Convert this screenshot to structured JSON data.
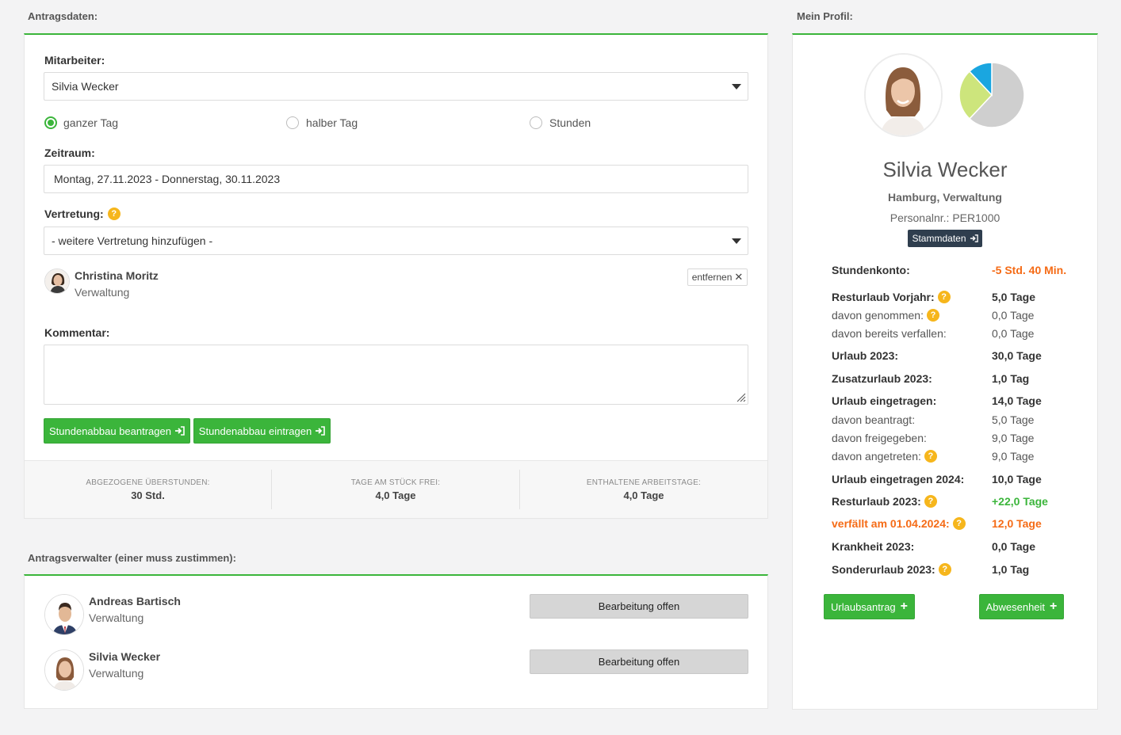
{
  "application": {
    "title": "Antragsdaten:",
    "employee": {
      "label": "Mitarbeiter:",
      "value": "Silvia Wecker"
    },
    "day_type": {
      "options": [
        {
          "label": "ganzer Tag",
          "selected": true
        },
        {
          "label": "halber Tag",
          "selected": false
        },
        {
          "label": "Stunden",
          "selected": false
        }
      ]
    },
    "period": {
      "label": "Zeitraum:",
      "value": "Montag, 27.11.2023 - Donnerstag, 30.11.2023"
    },
    "substitute": {
      "label": "Vertretung:",
      "select_value": "- weitere Vertretung hinzufügen -",
      "person": {
        "name": "Christina Moritz",
        "department": "Verwaltung"
      },
      "remove_label": "entfernen"
    },
    "comment": {
      "label": "Kommentar:",
      "value": ""
    },
    "buttons": {
      "request": "Stundenabbau beantragen",
      "enter": "Stundenabbau eintragen"
    },
    "stats": [
      {
        "label": "ABGEZOGENE ÜBERSTUNDEN:",
        "value": "30 Std."
      },
      {
        "label": "TAGE AM STÜCK FREI:",
        "value": "4,0 Tage"
      },
      {
        "label": "ENTHALTENE ARBEITSTAGE:",
        "value": "4,0 Tage"
      }
    ]
  },
  "approvers": {
    "title": "Antragsverwalter (einer muss zustimmen):",
    "items": [
      {
        "name": "Andreas Bartisch",
        "department": "Verwaltung",
        "status": "Bearbeitung offen"
      },
      {
        "name": "Silvia Wecker",
        "department": "Verwaltung",
        "status": "Bearbeitung offen"
      }
    ]
  },
  "profile": {
    "title": "Mein Profil:",
    "name": "Silvia Wecker",
    "location": "Hamburg, Verwaltung",
    "personnel_no": "Personalnr.: PER1000",
    "master_data_button": "Stammdaten",
    "pie": {
      "slices": [
        {
          "name": "gray",
          "value": 62,
          "color": "#cfcfcf"
        },
        {
          "name": "lime",
          "value": 26,
          "color": "#cde57c"
        },
        {
          "name": "blue",
          "value": 12,
          "color": "#1aa6e0"
        }
      ]
    },
    "rows": [
      {
        "key": "Stundenkonto:",
        "value": "-5 Std. 40 Min.",
        "kstyle": "b",
        "vstyle": "orange",
        "help": false
      },
      {
        "key": "Resturlaub Vorjahr:",
        "value": "5,0 Tage",
        "kstyle": "b",
        "vstyle": "b",
        "help": true
      },
      {
        "key": "davon genommen:",
        "value": "0,0 Tage",
        "kstyle": "n",
        "vstyle": "n",
        "help": true
      },
      {
        "key": "davon bereits verfallen:",
        "value": "0,0 Tage",
        "kstyle": "n",
        "vstyle": "n",
        "help": false
      },
      {
        "key": "Urlaub 2023:",
        "value": "30,0 Tage",
        "kstyle": "b",
        "vstyle": "b",
        "help": false
      },
      {
        "key": "Zusatzurlaub 2023:",
        "value": "1,0 Tag",
        "kstyle": "b",
        "vstyle": "b",
        "help": false
      },
      {
        "key": "Urlaub eingetragen:",
        "value": "14,0 Tage",
        "kstyle": "b",
        "vstyle": "b",
        "help": false
      },
      {
        "key": "davon beantragt:",
        "value": "5,0 Tage",
        "kstyle": "n",
        "vstyle": "n",
        "help": false
      },
      {
        "key": "davon freigegeben:",
        "value": "9,0 Tage",
        "kstyle": "n",
        "vstyle": "n",
        "help": false
      },
      {
        "key": "davon angetreten:",
        "value": "9,0 Tage",
        "kstyle": "n",
        "vstyle": "n",
        "help": true
      },
      {
        "key": "Urlaub eingetragen 2024:",
        "value": "10,0 Tage",
        "kstyle": "b",
        "vstyle": "b",
        "help": false
      },
      {
        "key": "Resturlaub 2023:",
        "value": "+22,0 Tage",
        "kstyle": "b",
        "vstyle": "green",
        "help": true
      },
      {
        "key": "verfällt am 01.04.2024:",
        "value": "12,0 Tage",
        "kstyle": "orange",
        "vstyle": "orange",
        "help": true
      },
      {
        "key": "Krankheit 2023:",
        "value": "0,0 Tage",
        "kstyle": "b",
        "vstyle": "b",
        "help": false
      },
      {
        "key": "Sonderurlaub 2023:",
        "value": "1,0 Tag",
        "kstyle": "b",
        "vstyle": "b",
        "help": true
      }
    ],
    "buttons": {
      "vacation": "Urlaubsantrag",
      "absence": "Abwesenheit"
    }
  },
  "colors": {
    "accent": "#3bb53b",
    "warning": "#f56b16",
    "help": "#f6b61c",
    "dark_button": "#2f3e4e"
  },
  "icons": {
    "help": "question-icon",
    "enter": "sign-in-icon",
    "remove": "close-icon",
    "add": "plus-icon",
    "dropdown": "caret-down-icon"
  }
}
